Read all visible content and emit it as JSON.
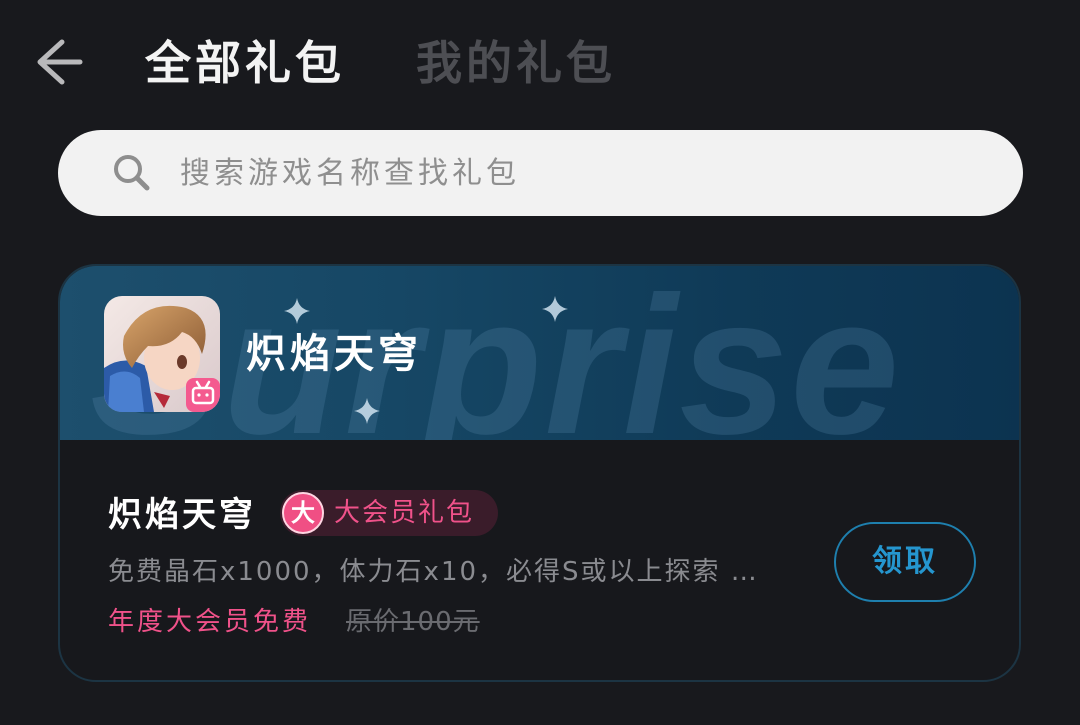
{
  "header": {
    "back_icon": "back-arrow-icon",
    "tabs": [
      {
        "label": "全部礼包",
        "active": true
      },
      {
        "label": "我的礼包",
        "active": false
      }
    ]
  },
  "search": {
    "icon": "search-icon",
    "placeholder": "搜索游戏名称查找礼包"
  },
  "card": {
    "banner": {
      "watermark": "Surprise",
      "game_title": "炽焰天穹",
      "game_icon": "game-icon"
    },
    "gift": {
      "name": "炽焰天穹",
      "badge_icon_text": "大",
      "badge_label": "大会员礼包",
      "description": "免费晶石x1000，体力石x10，必得S或以上探索 …",
      "price_label": "年度大会员免费",
      "original_price": "原价100元",
      "claim_label": "领取"
    }
  },
  "colors": {
    "background": "#18191d",
    "accent_pink": "#f0528a",
    "accent_blue": "#2596cf",
    "banner_blue": "#164765"
  }
}
